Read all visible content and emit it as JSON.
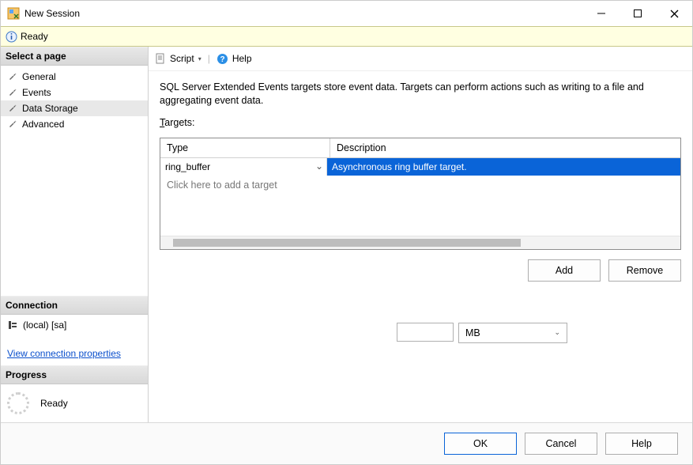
{
  "window": {
    "title": "New Session"
  },
  "status": {
    "text": "Ready"
  },
  "sidebar": {
    "select_page": "Select a page",
    "nav": {
      "general": "General",
      "events": "Events",
      "data_storage": "Data Storage",
      "advanced": "Advanced"
    },
    "connection_hdr": "Connection",
    "connection_text": "(local) [sa]",
    "view_conn_link": "View connection properties",
    "progress_hdr": "Progress",
    "progress_text": "Ready"
  },
  "toolbar": {
    "script": "Script",
    "help": "Help"
  },
  "main": {
    "description": "SQL Server Extended Events targets store event data. Targets can perform actions such as writing to a file and aggregating event data.",
    "targets_label": "Targets:",
    "columns": {
      "type": "Type",
      "desc": "Description"
    },
    "rows": [
      {
        "type": "ring_buffer",
        "desc": "Asynchronous ring buffer target."
      }
    ],
    "placeholder": "Click here to add a target",
    "add": "Add",
    "remove": "Remove",
    "unit_value": "",
    "unit_options_selected": "MB"
  },
  "footer": {
    "ok": "OK",
    "cancel": "Cancel",
    "help": "Help"
  }
}
